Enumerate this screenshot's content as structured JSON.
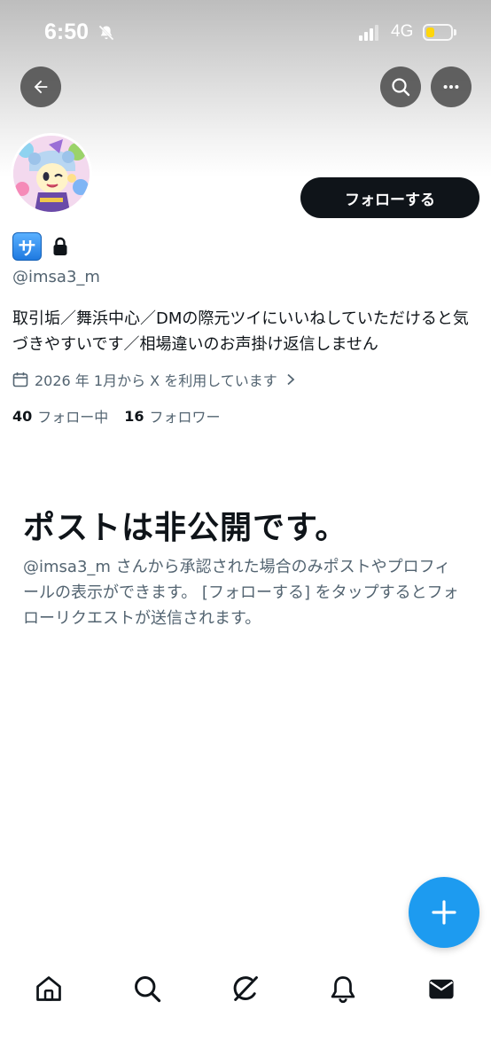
{
  "status_bar": {
    "time": "6:50",
    "network": "4G",
    "battery_level": 0.35,
    "icons": [
      "bell-off-icon",
      "signal-icon",
      "battery-icon"
    ]
  },
  "nav": {
    "icons": [
      "back-arrow-icon",
      "search-icon",
      "more-icon"
    ]
  },
  "profile": {
    "name_badge": "サ",
    "handle": "@imsa3_m",
    "bio": "取引垢／舞浜中心／DMの際元ツイにいいねしていただけると気づきやすいです／相場違いのお声掛け返信しません",
    "joined": "2026 年 1月から X を利用しています",
    "following_count": "40",
    "following_label": "フォロー中",
    "followers_count": "16",
    "followers_label": "フォロワー",
    "follow_button": "フォローする"
  },
  "private_notice": {
    "title": "ポストは非公開です。",
    "description": "@imsa3_m さんから承認された場合のみポストやプロフィールの表示ができます。 [フォローする] をタップするとフォローリクエストが送信されます。"
  },
  "bottom_nav": {
    "items": [
      "home-icon",
      "search-icon",
      "grok-icon",
      "notifications-icon",
      "messages-icon"
    ]
  },
  "colors": {
    "accent": "#1d9bf0",
    "text_primary": "#0f1419",
    "text_secondary": "#536471",
    "button_dark": "#0f1419",
    "badge_blue": "#1f7ae0"
  }
}
